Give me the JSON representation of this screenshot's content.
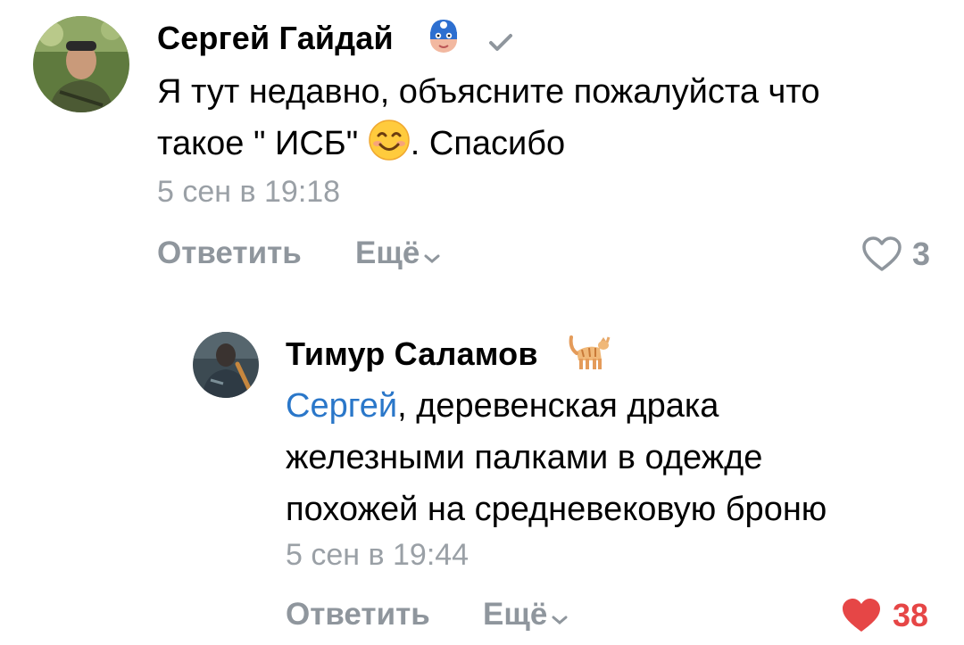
{
  "comments": [
    {
      "author": "Сергей Гайдай",
      "author_badge_icon": "captain-mask-icon",
      "verified_icon": "verified-check-icon",
      "text_line1": "Я тут недавно, объясните пожалуйста что",
      "text_line2_prefix": "такое \" ИСБ\" ",
      "text_emoji_icon": "smiling-face-icon",
      "text_line2_suffix": ". Спасибо",
      "time": "5 сен в 19:18",
      "reply_label": "Ответить",
      "more_label": "Ещё",
      "likes": "3",
      "liked": false
    },
    {
      "author": "Тимур Саламов",
      "author_badge_icon": "cat-icon",
      "mention": "Сергей",
      "text_line1_rest": ", деревенская драка",
      "text_line2": "железными палками в одежде",
      "text_line3": "похожей на средневековую броню",
      "time": "5 сен в 19:44",
      "reply_label": "Ответить",
      "more_label": "Ещё",
      "likes": "38",
      "liked": true
    }
  ],
  "colors": {
    "mention": "#2a77c9",
    "muted": "#8f969d",
    "liked_heart": "#e64646"
  }
}
